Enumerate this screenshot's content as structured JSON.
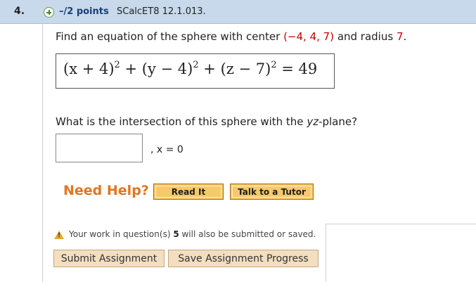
{
  "header": {
    "number": "4.",
    "points": "–/2 points",
    "question_id": "SCalcET8 12.1.013."
  },
  "question1": {
    "pre": "Find an equation of the sphere with center ",
    "center": "(−4, 4, 7)",
    "mid": " and radius ",
    "radius": "7",
    "end": "."
  },
  "answer": {
    "t1": "(x + 4)",
    "t2": " + (y − 4)",
    "t3": " + (z − 7)",
    "t4": " = 49",
    "exp": "2"
  },
  "question2": {
    "pre": "What is the intersection of this sphere with the ",
    "plane": "yz",
    "post": "-plane?"
  },
  "input": {
    "value": ""
  },
  "condition": ", x = 0",
  "help": {
    "label": "Need Help?",
    "read_it": "Read It",
    "talk": "Talk to a Tutor"
  },
  "warning": {
    "pre": "Your work in question(s) ",
    "num": "5",
    "post": " will also be submitted or saved."
  },
  "buttons": {
    "submit": "Submit Assignment",
    "save": "Save Assignment Progress"
  },
  "colors": {
    "header_bg": "#c7d9ea",
    "red": "#cc0000",
    "help_orange": "#e3761d"
  }
}
